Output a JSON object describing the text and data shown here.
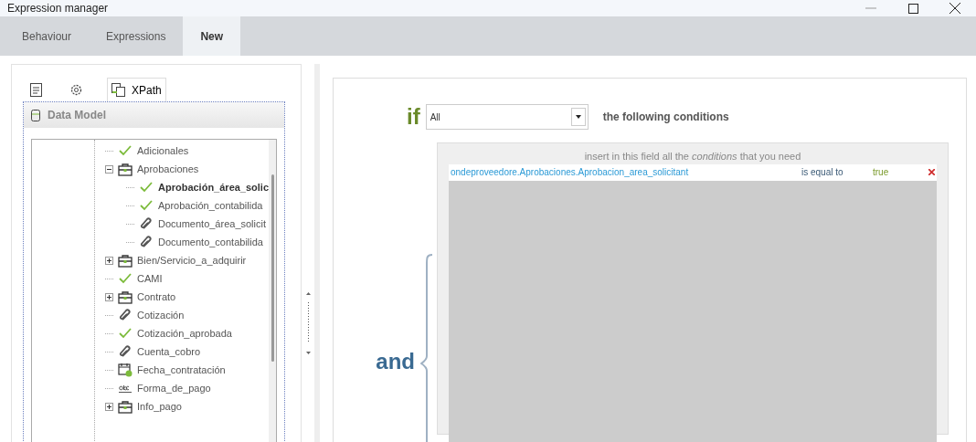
{
  "window": {
    "title": "Expression manager"
  },
  "tabs": [
    {
      "label": "Behaviour",
      "selected": false
    },
    {
      "label": "Expressions",
      "selected": false
    },
    {
      "label": "New",
      "selected": true
    }
  ],
  "left_panel": {
    "tool_tabs": [
      {
        "kind": "document",
        "selected": false
      },
      {
        "kind": "gear",
        "selected": false
      },
      {
        "kind": "xpath",
        "label": "XPath",
        "selected": true
      }
    ],
    "header": "Data Model",
    "tree": [
      {
        "label": "Adicionales",
        "kind": "boolean",
        "selected": false
      },
      {
        "label": "Aprobaciones",
        "kind": "entity",
        "expanded": true,
        "selected": false,
        "children": [
          {
            "label": "Aprobación_área_solic",
            "kind": "boolean",
            "selected": true
          },
          {
            "label": "Aprobación_contabilida",
            "kind": "boolean",
            "selected": false
          },
          {
            "label": "Documento_área_solicit",
            "kind": "file",
            "selected": false
          },
          {
            "label": "Documento_contabilida",
            "kind": "file",
            "selected": false
          }
        ]
      },
      {
        "label": "Bien/Servicio_a_adquirir",
        "kind": "entity",
        "expanded": false,
        "selected": false
      },
      {
        "label": "CAMI",
        "kind": "boolean",
        "selected": false
      },
      {
        "label": "Contrato",
        "kind": "entity",
        "expanded": false,
        "selected": false
      },
      {
        "label": "Cotización",
        "kind": "file",
        "selected": false
      },
      {
        "label": "Cotización_aprobada",
        "kind": "boolean",
        "selected": false
      },
      {
        "label": "Cuenta_cobro",
        "kind": "file",
        "selected": false
      },
      {
        "label": "Fecha_contratación",
        "kind": "date",
        "selected": false
      },
      {
        "label": "Forma_de_pago",
        "kind": "text",
        "selected": false
      },
      {
        "label": "Info_pago",
        "kind": "entity",
        "expanded": false,
        "selected": false
      }
    ]
  },
  "editor": {
    "if_label": "if",
    "quantifier": {
      "value": "All"
    },
    "following": "the following conditions",
    "and_label": "and",
    "hint": "insert in this field all the *conditions* that you need",
    "conditions": [
      {
        "field": "ondeproveedore.Aprobaciones.Aprobacion_area_solicitant",
        "operator": "is equal to",
        "value": "true"
      }
    ]
  }
}
